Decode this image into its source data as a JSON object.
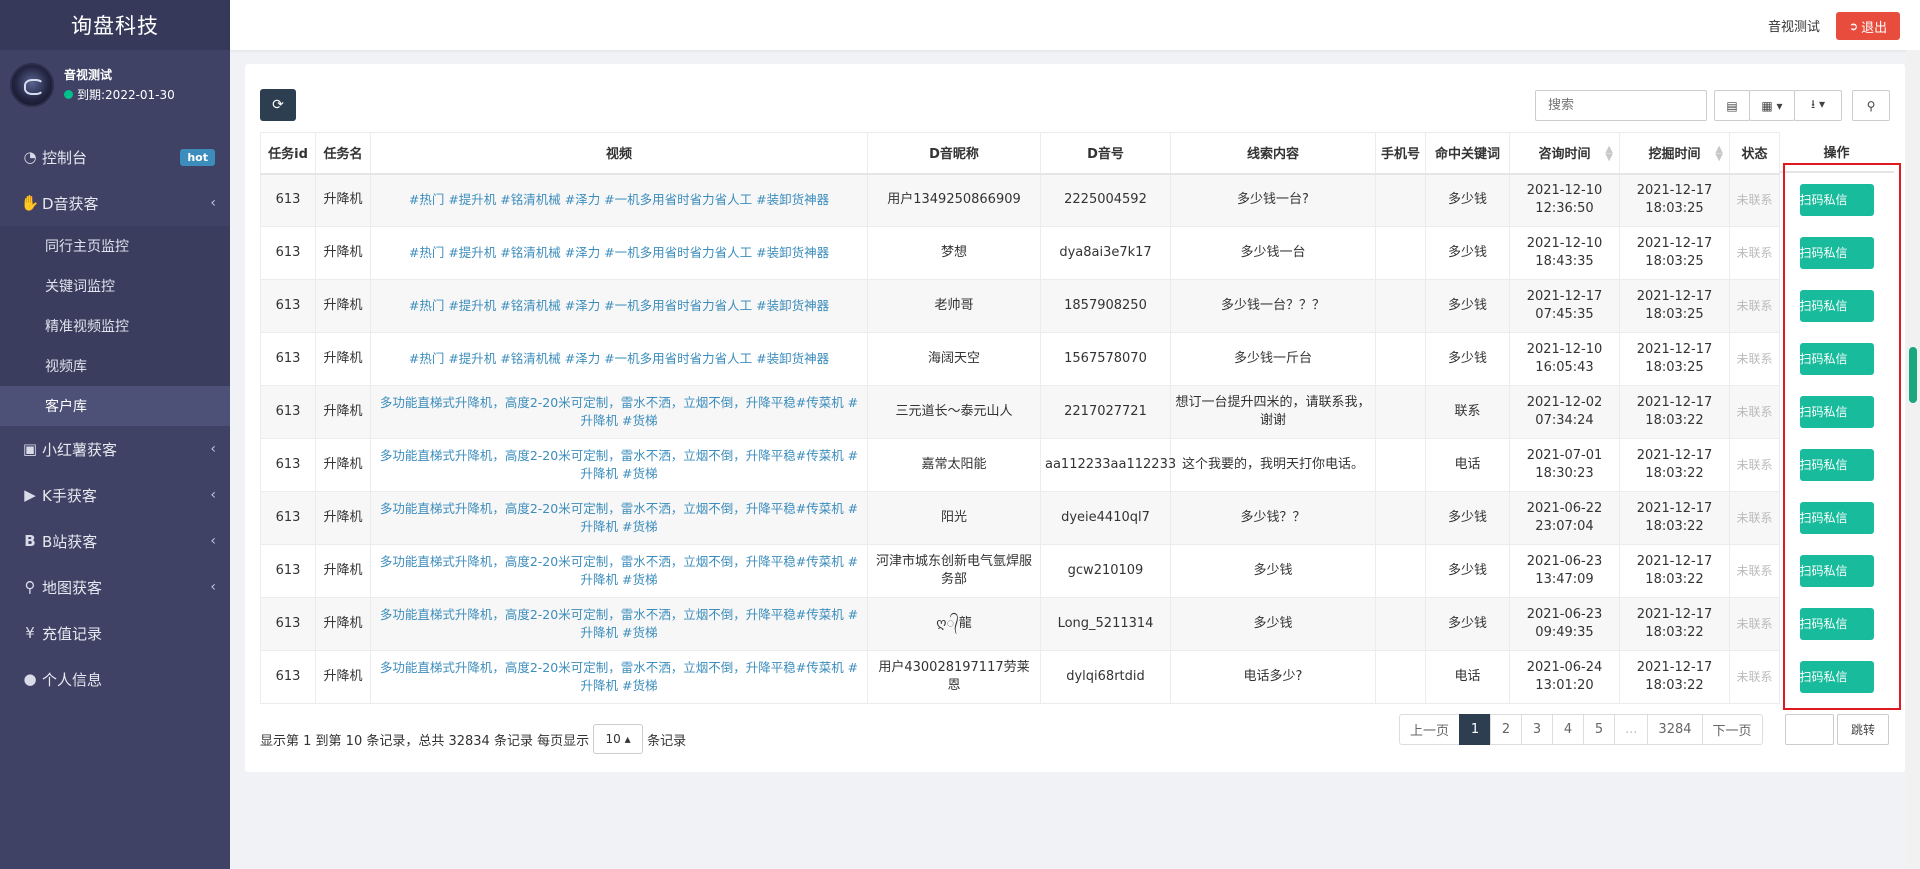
{
  "brand": "询盘科技",
  "user": {
    "name": "音视测试",
    "expire": "到期:2022-01-30"
  },
  "header": {
    "user_label": "音视测试",
    "logout": "退出"
  },
  "menu": {
    "dashboard": {
      "label": "控制台",
      "badge": "hot"
    },
    "douyin": {
      "label": "D音获客"
    },
    "douyin_sub": [
      "同行主页监控",
      "关键词监控",
      "精准视频监控",
      "视频库",
      "客户库"
    ],
    "xiaohongshu": {
      "label": "小红薯获客"
    },
    "kuaishou": {
      "label": "K手获客"
    },
    "bilibili": {
      "label": "B站获客"
    },
    "map": {
      "label": "地图获客"
    },
    "recharge": {
      "label": "充值记录"
    },
    "profile": {
      "label": "个人信息"
    }
  },
  "toolbar": {
    "search_placeholder": "搜索"
  },
  "table": {
    "headers": [
      "任务id",
      "任务名",
      "视频",
      "D音昵称",
      "D音号",
      "线索内容",
      "手机号",
      "命中关键词",
      "咨询时间",
      "挖掘时间",
      "状态"
    ],
    "action_header": "操作",
    "action_label": "扫码私信",
    "rows": [
      [
        "613",
        "升降机",
        "#热门 #提升机 #铭清机械 #泽力 #一机多用省时省力省人工 #装卸货神器",
        "用户1349250866909",
        "2225004592",
        "多少钱一台?",
        "",
        "多少钱",
        "2021-12-10 12:36:50",
        "2021-12-17 18:03:25",
        "未联系"
      ],
      [
        "613",
        "升降机",
        "#热门 #提升机 #铭清机械 #泽力 #一机多用省时省力省人工 #装卸货神器",
        "梦想",
        "dya8ai3e7k17",
        "多少钱一台",
        "",
        "多少钱",
        "2021-12-10 18:43:35",
        "2021-12-17 18:03:25",
        "未联系"
      ],
      [
        "613",
        "升降机",
        "#热门 #提升机 #铭清机械 #泽力 #一机多用省时省力省人工 #装卸货神器",
        "老帅哥",
        "1857908250",
        "多少钱一台？？？",
        "",
        "多少钱",
        "2021-12-17 07:45:35",
        "2021-12-17 18:03:25",
        "未联系"
      ],
      [
        "613",
        "升降机",
        "#热门 #提升机 #铭清机械 #泽力 #一机多用省时省力省人工 #装卸货神器",
        "海阔天空",
        "1567578070",
        "多少钱一斤台",
        "",
        "多少钱",
        "2021-12-10 16:05:43",
        "2021-12-17 18:03:25",
        "未联系"
      ],
      [
        "613",
        "升降机",
        "多功能直梯式升降机，高度2-20米可定制，雷水不洒，立烟不倒，升降平稳#传菜机 #升降机 #货梯",
        "三元道长～泰元山人",
        "2217027721",
        "想订一台提升四米的，请联系我，谢谢",
        "",
        "联系",
        "2021-12-02 07:34:24",
        "2021-12-17 18:03:22",
        "未联系"
      ],
      [
        "613",
        "升降机",
        "多功能直梯式升降机，高度2-20米可定制，雷水不洒，立烟不倒，升降平稳#传菜机 #升降机 #货梯",
        "嘉常太阳能",
        "aa112233aa112233",
        "这个我要的，我明天打你电话。",
        "",
        "电话",
        "2021-07-01 18:30:23",
        "2021-12-17 18:03:22",
        "未联系"
      ],
      [
        "613",
        "升降机",
        "多功能直梯式升降机，高度2-20米可定制，雷水不洒，立烟不倒，升降平稳#传菜机 #升降机 #货梯",
        "阳光",
        "dyeie4410ql7",
        "多少钱？？",
        "",
        "多少钱",
        "2021-06-22 23:07:04",
        "2021-12-17 18:03:22",
        "未联系"
      ],
      [
        "613",
        "升降机",
        "多功能直梯式升降机，高度2-20米可定制，雷水不洒，立烟不倒，升降平稳#传菜机 #升降机 #货梯",
        "河津市城东创新电气氩焊服务部",
        "gcw210109",
        "多少钱",
        "",
        "多少钱",
        "2021-06-23 13:47:09",
        "2021-12-17 18:03:22",
        "未联系"
      ],
      [
        "613",
        "升降机",
        "多功能直梯式升降机，高度2-20米可定制，雷水不洒，立烟不倒，升降平稳#传菜机 #升降机 #货梯",
        "ღ᭄龍",
        "Long_5211314",
        "多少钱",
        "",
        "多少钱",
        "2021-06-23 09:49:35",
        "2021-12-17 18:03:22",
        "未联系"
      ],
      [
        "613",
        "升降机",
        "多功能直梯式升降机，高度2-20米可定制，雷水不洒，立烟不倒，升降平稳#传菜机 #升降机 #货梯",
        "用户430028197117劳莱恩",
        "dylqi68rtdid",
        "电话多少?",
        "",
        "电话",
        "2021-06-24 13:01:20",
        "2021-12-17 18:03:22",
        "未联系"
      ]
    ]
  },
  "footer": {
    "info_prefix": "显示第 1 到第 10 条记录，总共 32834 条记录 每页显示",
    "page_size": "10",
    "info_suffix": "条记录"
  },
  "pagination": {
    "prev": "上一页",
    "pages": [
      "1",
      "2",
      "3",
      "4",
      "5",
      "...",
      "3284"
    ],
    "next": "下一页",
    "jump": "跳转"
  }
}
